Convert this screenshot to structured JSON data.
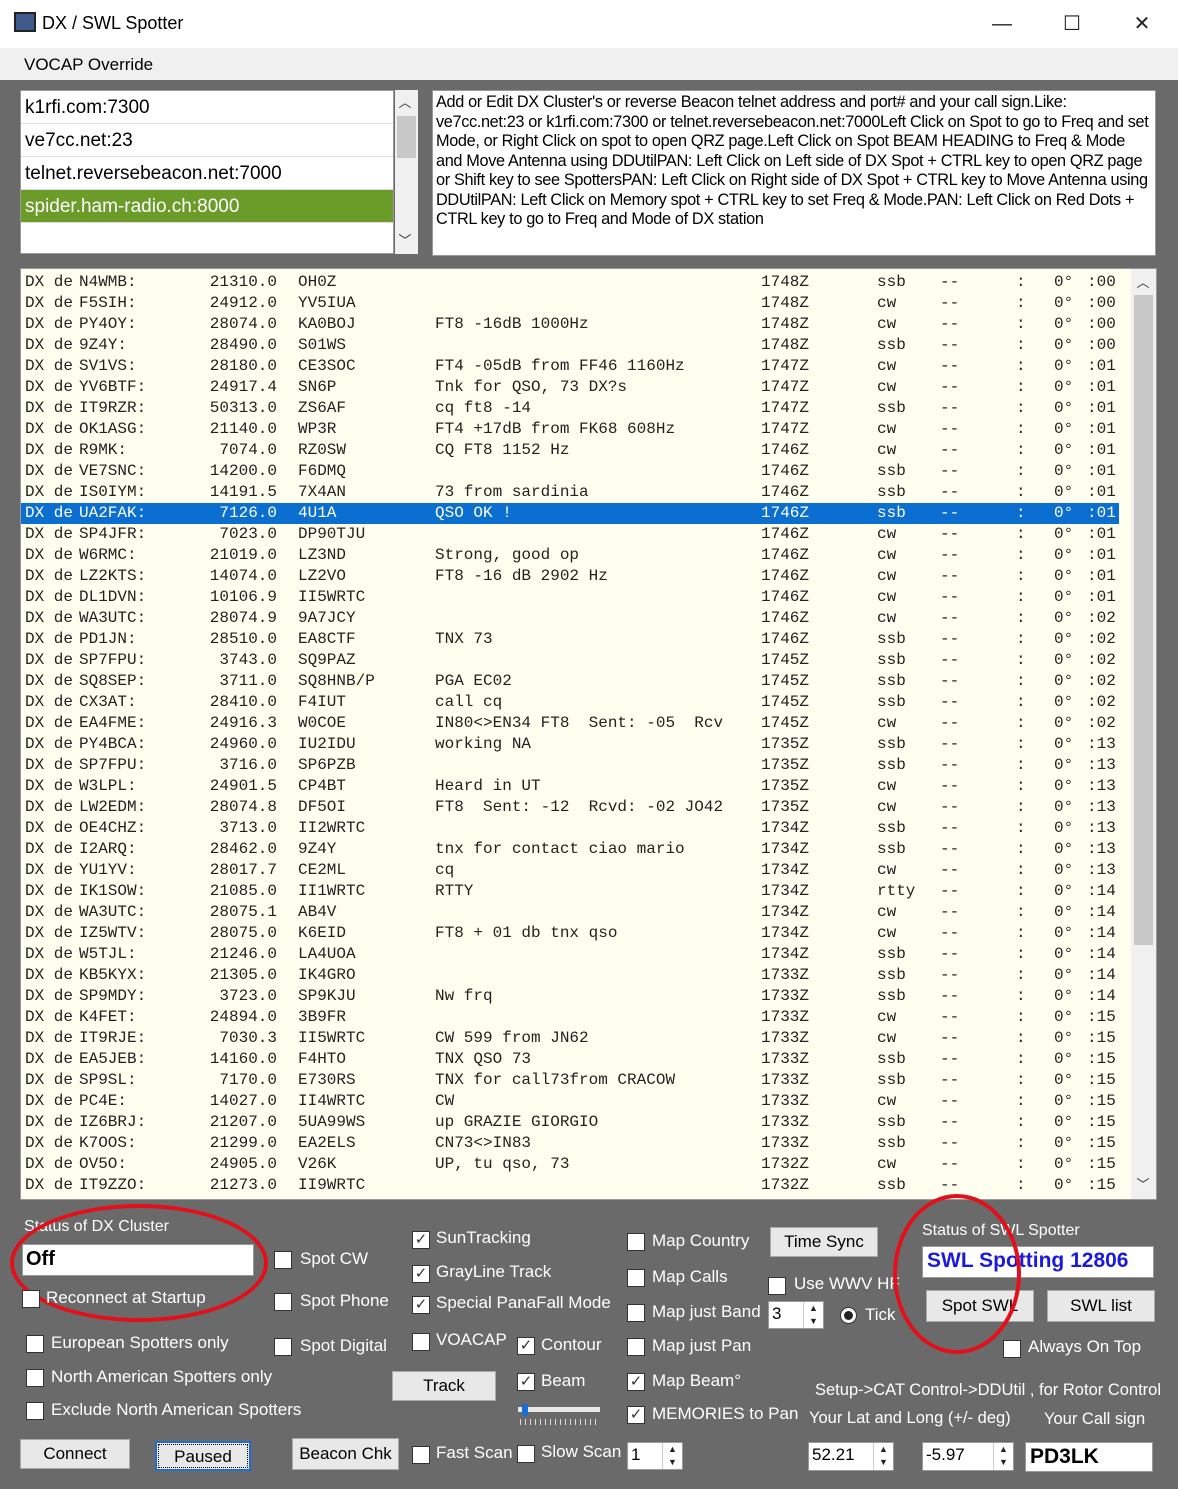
{
  "window": {
    "title": "DX / SWL Spotter",
    "minimize": "—",
    "maximize": "☐",
    "close": "✕"
  },
  "menu": {
    "voacap_override": "VOCAP Override"
  },
  "clusters": [
    "k1rfi.com:7300",
    "ve7cc.net:23",
    "telnet.reversebeacon.net:7000",
    "spider.ham-radio.ch:8000"
  ],
  "clusters_selected": 3,
  "help_text": "Add or Edit DX Cluster's or reverse Beacon telnet address and port# and your call sign.Like: ve7cc.net:23 or k1rfi.com:7300 or telnet.reversebeacon.net:7000Left Click on Spot to go to Freq and set Mode, or Right Click on spot to open QRZ page.Left Click on Spot BEAM HEADING to Freq & Mode and Move Antenna using DDUtilPAN: Left Click on Left side of DX Spot + CTRL key to open QRZ page or Shift key to see SpottersPAN: Left Click on Right side of DX Spot + CTRL key to Move Antenna using DDUtilPAN: Left Click on Memory spot + CTRL key  to set Freq & Mode.PAN: Left Click on Red Dots  + CTRL key to go to Freq and Mode of DX station",
  "spot_fixed": {
    "prefix": "DX de",
    "sep": "--",
    "colon": ":",
    "bearing": "0°"
  },
  "spots_selected": 11,
  "spots": [
    [
      "N4WMB:",
      "21310.0",
      "OH0Z",
      "",
      "1748Z",
      "ssb",
      ":00"
    ],
    [
      "F5SIH:",
      "24912.0",
      "YV5IUA",
      "",
      "1748Z",
      "cw",
      ":00"
    ],
    [
      "PY4OY:",
      "28074.0",
      "KA0BOJ",
      "FT8 -16dB 1000Hz",
      "1748Z",
      "cw",
      ":00"
    ],
    [
      "9Z4Y:",
      "28490.0",
      "S01WS",
      "",
      "1748Z",
      "ssb",
      ":00"
    ],
    [
      "SV1VS:",
      "28180.0",
      "CE3SOC",
      "FT4 -05dB from FF46 1160Hz",
      "1747Z",
      "cw",
      ":01"
    ],
    [
      "YV6BTF:",
      "24917.4",
      "SN6P",
      "Tnk for QSO, 73 DX?s",
      "1747Z",
      "cw",
      ":01"
    ],
    [
      "IT9RZR:",
      "50313.0",
      "ZS6AF",
      "cq ft8 -14",
      "1747Z",
      "ssb",
      ":01"
    ],
    [
      "OK1ASG:",
      "21140.0",
      "WP3R",
      "FT4 +17dB from FK68 608Hz",
      "1747Z",
      "cw",
      ":01"
    ],
    [
      "R9MK:",
      "7074.0",
      "RZ0SW",
      "CQ FT8 1152 Hz",
      "1746Z",
      "cw",
      ":01"
    ],
    [
      "VE7SNC:",
      "14200.0",
      "F6DMQ",
      "",
      "1746Z",
      "ssb",
      ":01"
    ],
    [
      "IS0IYM:",
      "14191.5",
      "7X4AN",
      "73 from sardinia",
      "1746Z",
      "ssb",
      ":01"
    ],
    [
      "UA2FAK:",
      "7126.0",
      "4U1A",
      "QSO OK !",
      "1746Z",
      "ssb",
      ":01"
    ],
    [
      "SP4JFR:",
      "7023.0",
      "DP90TJU",
      "",
      "1746Z",
      "cw",
      ":01"
    ],
    [
      "W6RMC:",
      "21019.0",
      "LZ3ND",
      "Strong, good op",
      "1746Z",
      "cw",
      ":01"
    ],
    [
      "LZ2KTS:",
      "14074.0",
      "LZ2VO",
      "FT8 -16 dB 2902 Hz",
      "1746Z",
      "cw",
      ":01"
    ],
    [
      "DL1DVN:",
      "10106.9",
      "II5WRTC",
      "",
      "1746Z",
      "cw",
      ":01"
    ],
    [
      "WA3UTC:",
      "28074.9",
      "9A7JCY",
      "",
      "1746Z",
      "cw",
      ":02"
    ],
    [
      "PD1JN:",
      "28510.0",
      "EA8CTF",
      "TNX 73",
      "1746Z",
      "ssb",
      ":02"
    ],
    [
      "SP7FPU:",
      "3743.0",
      "SQ9PAZ",
      "",
      "1745Z",
      "ssb",
      ":02"
    ],
    [
      "SQ8SEP:",
      "3711.0",
      "SQ8HNB/P",
      "PGA EC02",
      "1745Z",
      "ssb",
      ":02"
    ],
    [
      "CX3AT:",
      "28410.0",
      "F4IUT",
      "call cq",
      "1745Z",
      "ssb",
      ":02"
    ],
    [
      "EA4FME:",
      "24916.3",
      "W0COE",
      "IN80<>EN34 FT8  Sent: -05  Rcv",
      "1745Z",
      "cw",
      ":02"
    ],
    [
      "PY4BCA:",
      "24960.0",
      "IU2IDU",
      "working NA",
      "1735Z",
      "ssb",
      ":13"
    ],
    [
      "SP7FPU:",
      "3716.0",
      "SP6PZB",
      "",
      "1735Z",
      "ssb",
      ":13"
    ],
    [
      "W3LPL:",
      "24901.5",
      "CP4BT",
      "Heard in UT",
      "1735Z",
      "cw",
      ":13"
    ],
    [
      "LW2EDM:",
      "28074.8",
      "DF5OI",
      "FT8  Sent: -12  Rcvd: -02 JO42",
      "1735Z",
      "cw",
      ":13"
    ],
    [
      "OE4CHZ:",
      "3713.0",
      "II2WRTC",
      "",
      "1734Z",
      "ssb",
      ":13"
    ],
    [
      "I2ARQ:",
      "28462.0",
      "9Z4Y",
      "tnx for contact ciao mario",
      "1734Z",
      "ssb",
      ":13"
    ],
    [
      "YU1YV:",
      "28017.7",
      "CE2ML",
      "cq",
      "1734Z",
      "cw",
      ":13"
    ],
    [
      "IK1SOW:",
      "21085.0",
      "II1WRTC",
      "RTTY",
      "1734Z",
      "rtty",
      ":14"
    ],
    [
      "WA3UTC:",
      "28075.1",
      "AB4V",
      "",
      "1734Z",
      "cw",
      ":14"
    ],
    [
      "IZ5WTV:",
      "28075.0",
      "K6EID",
      "FT8 + 01 db tnx qso",
      "1734Z",
      "cw",
      ":14"
    ],
    [
      "W5TJL:",
      "21246.0",
      "LA4UOA",
      "",
      "1734Z",
      "ssb",
      ":14"
    ],
    [
      "KB5KYX:",
      "21305.0",
      "IK4GRO",
      "",
      "1733Z",
      "ssb",
      ":14"
    ],
    [
      "SP9MDY:",
      "3723.0",
      "SP9KJU",
      "Nw frq",
      "1733Z",
      "ssb",
      ":14"
    ],
    [
      "K4FET:",
      "24894.0",
      "3B9FR",
      "",
      "1733Z",
      "cw",
      ":15"
    ],
    [
      "IT9RJE:",
      "7030.3",
      "II5WRTC",
      "CW 599 from JN62",
      "1733Z",
      "cw",
      ":15"
    ],
    [
      "EA5JEB:",
      "14160.0",
      "F4HTO",
      "TNX QSO 73",
      "1733Z",
      "ssb",
      ":15"
    ],
    [
      "SP9SL:",
      "7170.0",
      "E730RS",
      "TNX for call73from CRACOW",
      "1733Z",
      "ssb",
      ":15"
    ],
    [
      "PC4E:",
      "14027.0",
      "II4WRTC",
      "CW",
      "1733Z",
      "cw",
      ":15"
    ],
    [
      "IZ6BRJ:",
      "21207.0",
      "5UA99WS",
      "up GRAZIE GIORGIO",
      "1733Z",
      "ssb",
      ":15"
    ],
    [
      "K7OOS:",
      "21299.0",
      "EA2ELS",
      "CN73<>IN83",
      "1733Z",
      "ssb",
      ":15"
    ],
    [
      "OV5O:",
      "24905.0",
      "V26K",
      "UP, tu qso, 73",
      "1732Z",
      "cw",
      ":15"
    ],
    [
      "IT9ZZO:",
      "21273.0",
      "II9WRTC",
      "",
      "1732Z",
      "ssb",
      ":15"
    ]
  ],
  "controls": {
    "status_dx_label": "Status of DX Cluster",
    "status_dx_value": "Off",
    "reconnect": "Reconnect at Startup",
    "spot_cw": "Spot CW",
    "spot_phone": "Spot Phone",
    "spot_digital": "Spot Digital",
    "european": "European Spotters only",
    "north_american": "North American Spotters only",
    "exclude_na": "Exclude North American Spotters",
    "connect": "Connect",
    "paused": "Paused",
    "beacon_chk": "Beacon Chk",
    "suntracking": "SunTracking",
    "grayline": "GrayLine Track",
    "panafall": "Special PanaFall Mode",
    "voacap": "VOACAP",
    "contour": "Contour",
    "track": "Track",
    "beam": "Beam",
    "fast_scan": "Fast Scan",
    "slow_scan": "Slow Scan",
    "scan_value": "1",
    "map_country": "Map Country",
    "map_calls": "Map Calls",
    "map_band": "Map just Band",
    "map_pan": "Map just Pan",
    "map_beam": "Map Beam°",
    "memories": "MEMORIES to Pan",
    "time_sync": "Time Sync",
    "use_wwv": "Use WWV HF",
    "band_value": "3",
    "tick": "Tick",
    "status_swl_label": "Status of SWL Spotter",
    "status_swl_value": "SWL Spotting 12806",
    "spot_swl": "Spot SWL",
    "swl_list": "SWL list",
    "always_on_top": "Always On Top",
    "setup_hint": "Setup->CAT Control->DDUtil , for Rotor Control",
    "latlong_label": "Your Lat and Long (+/- deg)",
    "callsign_label": "Your Call sign",
    "lat": "52.21",
    "long": "-5.97",
    "callsign": "PD3LK"
  },
  "colors": {
    "selected_row": "#0a6fd1",
    "selected_cluster": "#6b9b28",
    "swl_status_text": "#1a1adf",
    "annotation_circle": "#e3101b"
  }
}
